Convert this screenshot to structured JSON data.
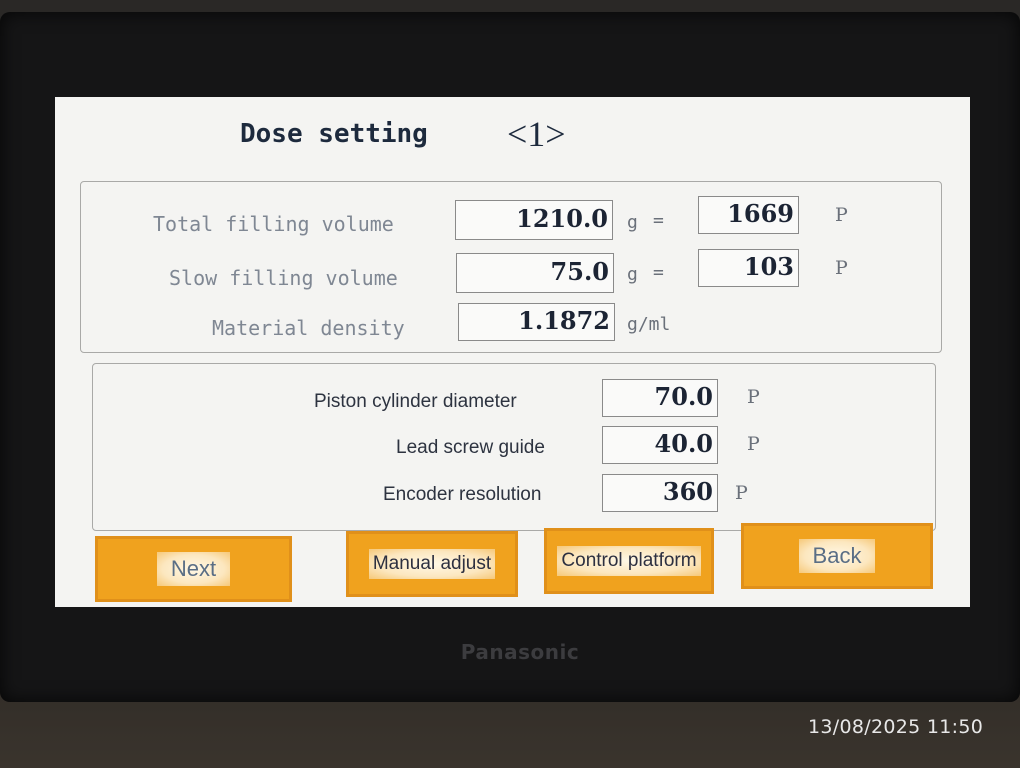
{
  "device": {
    "brand": "Panasonic"
  },
  "screen": {
    "title": "Dose setting",
    "page_indicator": "<1>"
  },
  "dose_panel": {
    "total_filling_volume": {
      "label": "Total filling volume",
      "value": "1210.0",
      "unit": "g",
      "equals": "=",
      "pulses": "1669",
      "pulse_unit": "P"
    },
    "slow_filling_volume": {
      "label": "Slow filling volume",
      "value": "75.0",
      "unit": "g",
      "equals": "=",
      "pulses": "103",
      "pulse_unit": "P"
    },
    "material_density": {
      "label": "Material density",
      "value": "1.1872",
      "unit": "g/ml"
    }
  },
  "mechanical_panel": {
    "piston_cylinder_diameter": {
      "label": "Piston cylinder diameter",
      "value": "70.0",
      "unit": "P"
    },
    "lead_screw_guide": {
      "label": "Lead screw guide",
      "value": "40.0",
      "unit": "P"
    },
    "encoder_resolution": {
      "label": "Encoder resolution",
      "value": "360",
      "unit": "P"
    }
  },
  "buttons": {
    "next": "Next",
    "manual_adjust": "Manual adjust",
    "control_platform": "Control platform",
    "back": "Back"
  },
  "photo_timestamp": "13/08/2025 11:50",
  "colors": {
    "button_orange": "#f0a21e",
    "screen_bg": "#f4f4f2",
    "value_text": "#1c2434",
    "label_text": "#7f8793"
  }
}
